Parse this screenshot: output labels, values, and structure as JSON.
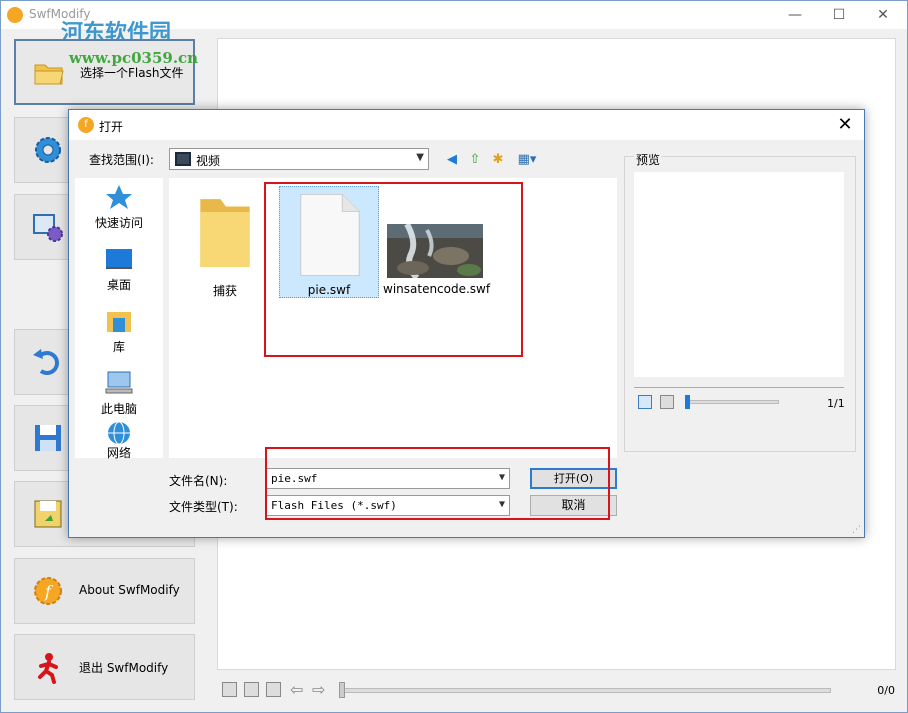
{
  "app": {
    "title": "SwfModify",
    "watermark": "河东软件园",
    "watermark_url": "www.pc0359.cn",
    "window_buttons": {
      "minimize": "—",
      "maximize": "☐",
      "close": "✕"
    },
    "sidebar": {
      "open_flash": "选择一个Flash文件",
      "undo_partial": "撤",
      "about": "About SwfModify",
      "exit": "退出 SwfModify"
    },
    "player": {
      "counter": "0/0"
    }
  },
  "dialog": {
    "title": "打开",
    "look_in_label": "查找范围(I):",
    "look_in_value": "视频",
    "places": [
      "快速访问",
      "桌面",
      "库",
      "此电脑",
      "网络"
    ],
    "files": [
      {
        "name": "捕获",
        "type": "folder"
      },
      {
        "name": "pie.swf",
        "type": "file",
        "selected": true
      },
      {
        "name": "winsatencode.swf",
        "type": "thumbnail"
      }
    ],
    "preview_label": "预览",
    "preview_counter": "1/1",
    "filename_label": "文件名(N):",
    "filename_value": "pie.swf",
    "filetype_label": "文件类型(T):",
    "filetype_value": "Flash Files (*.swf)",
    "open_button": "打开(O)",
    "cancel_button": "取消"
  },
  "colors": {
    "highlight_red": "#d8141b",
    "selection": "#cce8ff",
    "accent": "#2f7ad1"
  }
}
